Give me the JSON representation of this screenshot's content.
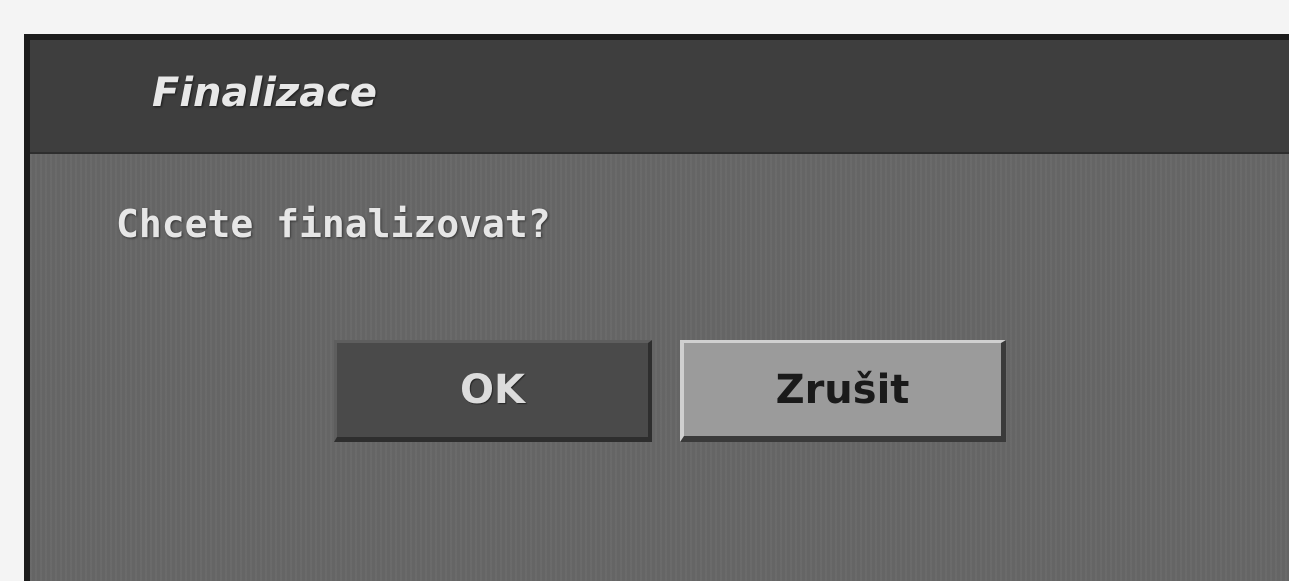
{
  "dialog": {
    "title": "Finalizace",
    "message": "Chcete finalizovat?",
    "buttons": {
      "ok_label": "OK",
      "cancel_label": "Zrušit",
      "selected": "cancel"
    }
  },
  "colors": {
    "title_bar": "#3e3e3e",
    "body": "#676767",
    "ok_button": "#4a4a4a",
    "cancel_button_highlighted": "#9b9b9b"
  }
}
